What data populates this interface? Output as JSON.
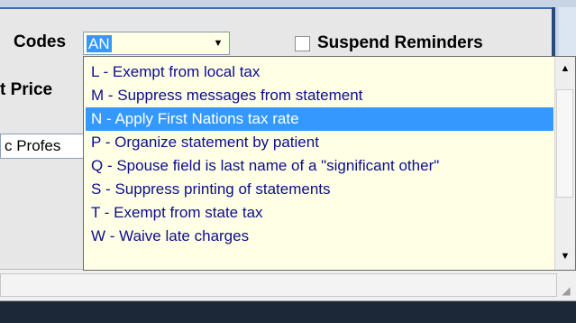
{
  "form": {
    "codes_label": "Codes",
    "codes_value": "AN",
    "suspend_label": "Suspend Reminders",
    "price_label": "t Price",
    "profes_field_text": "c Profes"
  },
  "dropdown": {
    "items": [
      {
        "label": "L - Exempt from local tax",
        "selected": false
      },
      {
        "label": "M - Suppress messages from statement",
        "selected": false
      },
      {
        "label": "N - Apply First Nations tax rate",
        "selected": true
      },
      {
        "label": "P - Organize statement by patient",
        "selected": false
      },
      {
        "label": "Q - Spouse field is last name of a \"significant other\"",
        "selected": false
      },
      {
        "label": "S - Suppress printing of statements",
        "selected": false
      },
      {
        "label": "T - Exempt from state tax",
        "selected": false
      },
      {
        "label": "W - Waive late charges",
        "selected": false
      }
    ]
  },
  "icons": {
    "combo_arrow": "chevron-down-icon",
    "scroll_up": "arrow-up-icon",
    "scroll_down": "arrow-down-icon",
    "resize_grip": "resize-grip-icon"
  },
  "colors": {
    "selection": "#3399ff",
    "list_background": "#ffffe6",
    "list_text": "#0d0d8c"
  }
}
